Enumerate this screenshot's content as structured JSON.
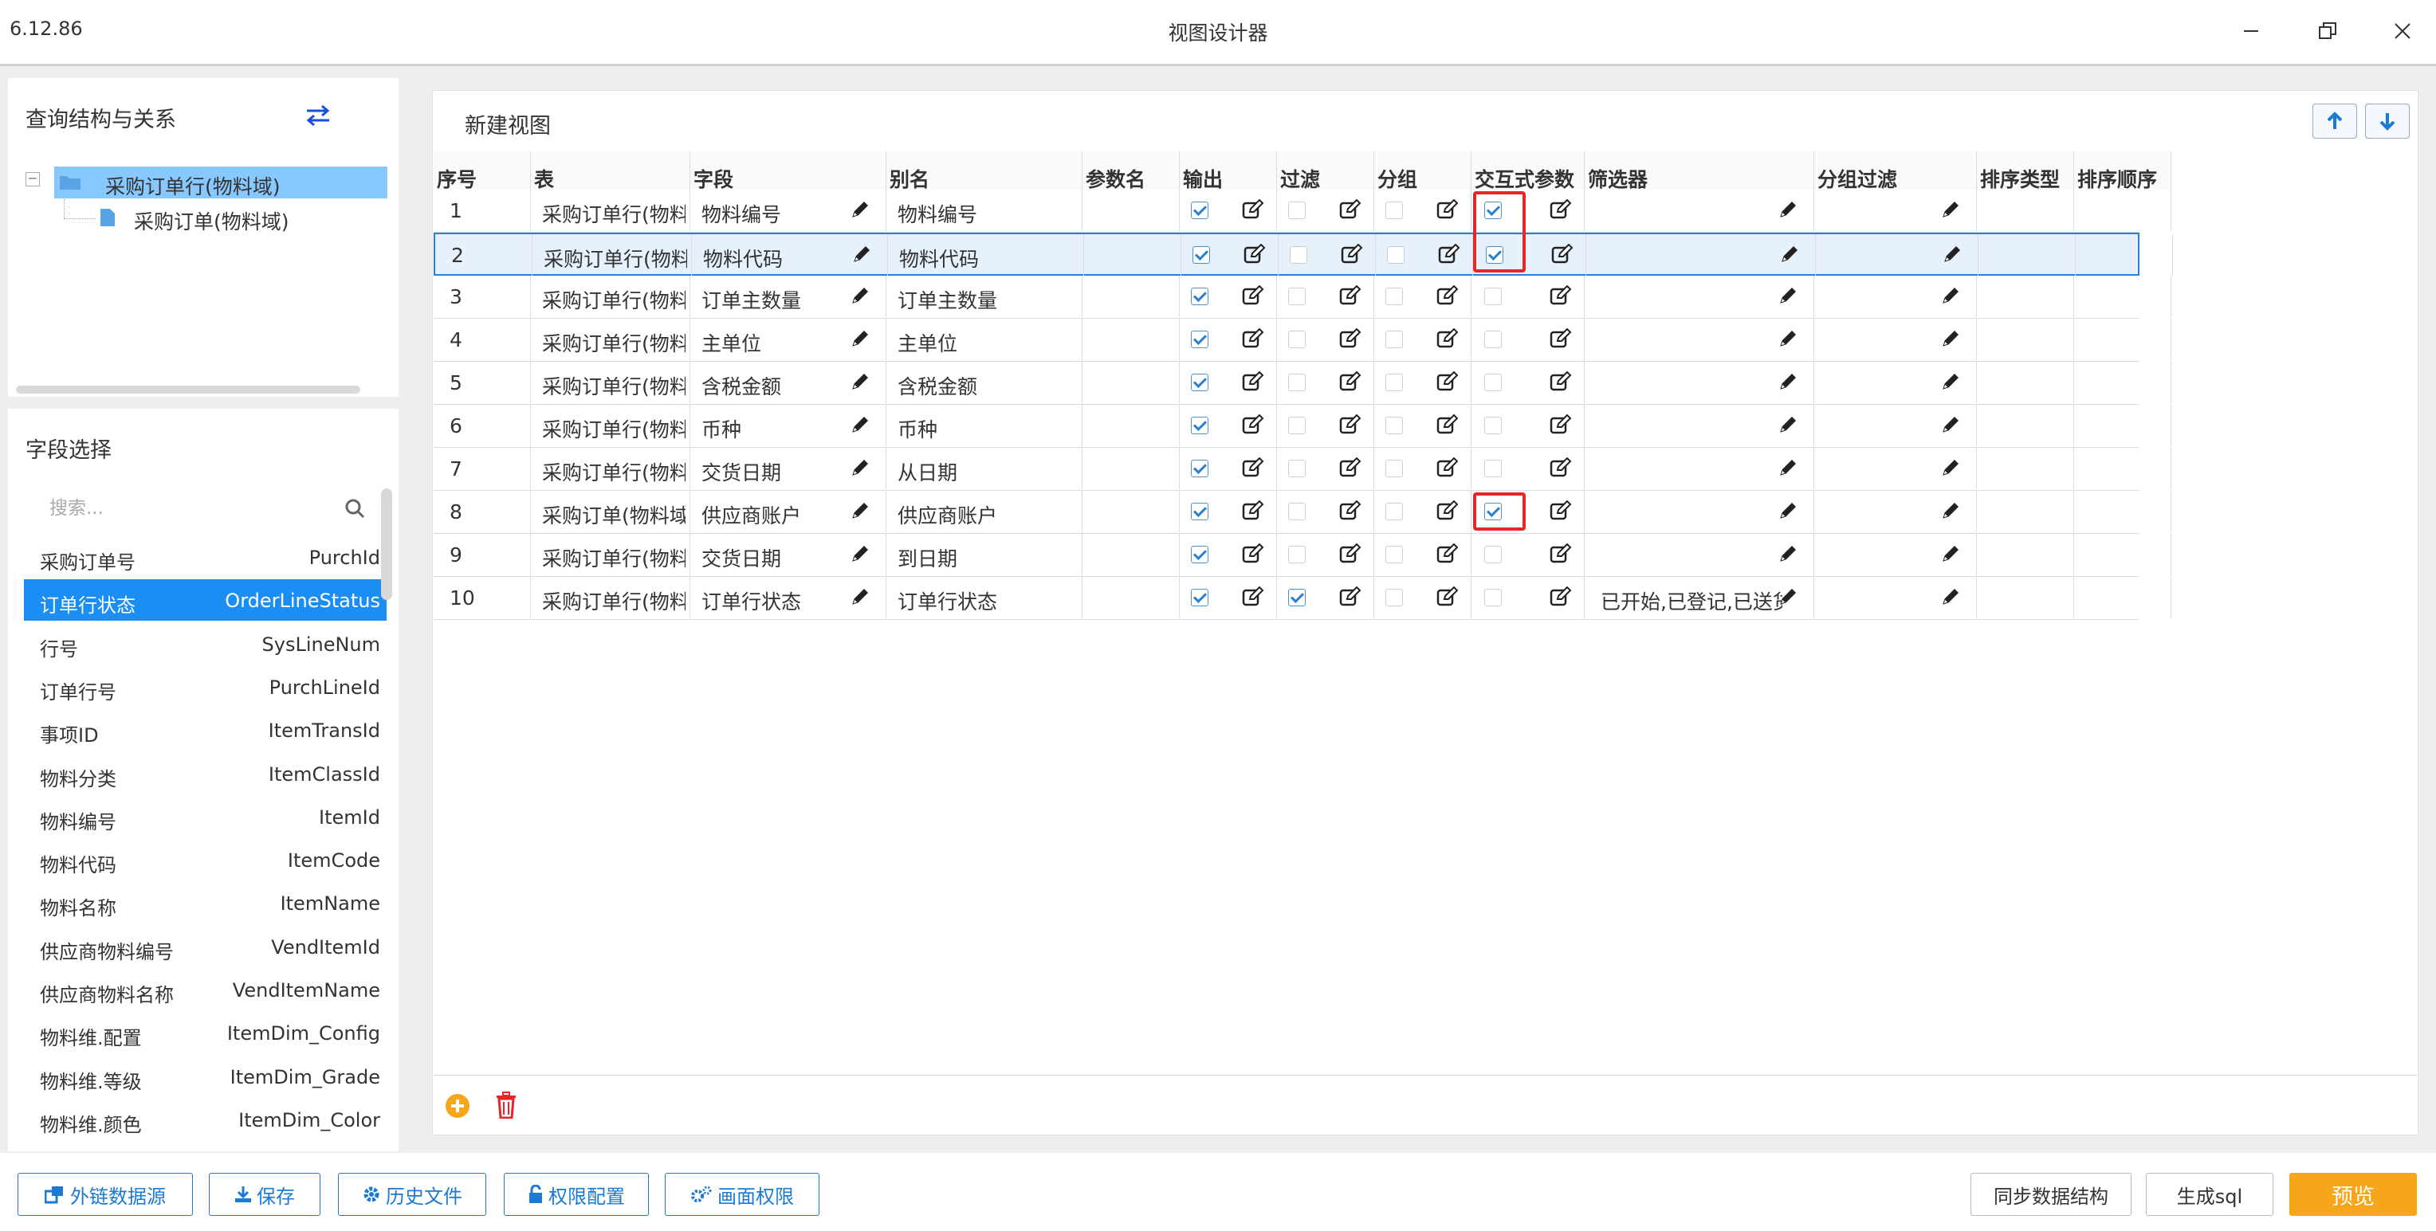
{
  "app": {
    "version": "6.12.86",
    "title": "视图设计器"
  },
  "colors": {
    "accent": "#1a8ef5",
    "preview_button": "#f7a51a",
    "highlight_box": "#e8262a",
    "tree_selected": "#87c8ff"
  },
  "left_top": {
    "title": "查询结构与关系",
    "swap_icon": "swap-arrows-icon",
    "tree": [
      {
        "label": "采购订单行(物料域)",
        "selected": true
      },
      {
        "label": "采购订单(物料域)",
        "selected": false
      }
    ]
  },
  "left_bottom": {
    "title": "字段选择",
    "search_placeholder": "搜索...",
    "fields": [
      {
        "cn": "采购订单号",
        "en": "PurchId"
      },
      {
        "cn": "订单行状态",
        "en": "OrderLineStatus"
      },
      {
        "cn": "行号",
        "en": "SysLineNum"
      },
      {
        "cn": "订单行号",
        "en": "PurchLineId"
      },
      {
        "cn": "事项ID",
        "en": "ItemTransId"
      },
      {
        "cn": "物料分类",
        "en": "ItemClassId"
      },
      {
        "cn": "物料编号",
        "en": "ItemId"
      },
      {
        "cn": "物料代码",
        "en": "ItemCode"
      },
      {
        "cn": "物料名称",
        "en": "ItemName"
      },
      {
        "cn": "供应商物料编号",
        "en": "VendItemId"
      },
      {
        "cn": "供应商物料名称",
        "en": "VendItemName"
      },
      {
        "cn": "物料维.配置",
        "en": "ItemDim_Config"
      },
      {
        "cn": "物料维.等级",
        "en": "ItemDim_Grade"
      },
      {
        "cn": "物料维.颜色",
        "en": "ItemDim_Color"
      }
    ],
    "selected_index": 1
  },
  "view": {
    "title": "新建视图",
    "columns": [
      "序号",
      "表",
      "字段",
      "别名",
      "参数名",
      "输出",
      "过滤",
      "分组",
      "交互式参数",
      "筛选器",
      "分组过滤",
      "排序类型",
      "排序顺序"
    ],
    "rows": [
      {
        "no": "1",
        "table": "采购订单行(物料",
        "field": "物料编号",
        "alias": "物料编号",
        "output": true,
        "filter": false,
        "group": false,
        "interactive": true,
        "filter_value": ""
      },
      {
        "no": "2",
        "table": "采购订单行(物料",
        "field": "物料代码",
        "alias": "物料代码",
        "output": true,
        "filter": false,
        "group": false,
        "interactive": true,
        "filter_value": ""
      },
      {
        "no": "3",
        "table": "采购订单行(物料",
        "field": "订单主数量",
        "alias": "订单主数量",
        "output": true,
        "filter": false,
        "group": false,
        "interactive": false,
        "filter_value": ""
      },
      {
        "no": "4",
        "table": "采购订单行(物料",
        "field": "主单位",
        "alias": "主单位",
        "output": true,
        "filter": false,
        "group": false,
        "interactive": false,
        "filter_value": ""
      },
      {
        "no": "5",
        "table": "采购订单行(物料",
        "field": "含税金额",
        "alias": "含税金额",
        "output": true,
        "filter": false,
        "group": false,
        "interactive": false,
        "filter_value": ""
      },
      {
        "no": "6",
        "table": "采购订单行(物料",
        "field": "币种",
        "alias": "币种",
        "output": true,
        "filter": false,
        "group": false,
        "interactive": false,
        "filter_value": ""
      },
      {
        "no": "7",
        "table": "采购订单行(物料",
        "field": "交货日期",
        "alias": "从日期",
        "output": true,
        "filter": false,
        "group": false,
        "interactive": false,
        "filter_value": ""
      },
      {
        "no": "8",
        "table": "采购订单(物料域",
        "field": "供应商账户",
        "alias": "供应商账户",
        "output": true,
        "filter": false,
        "group": false,
        "interactive": true,
        "filter_value": ""
      },
      {
        "no": "9",
        "table": "采购订单行(物料",
        "field": "交货日期",
        "alias": "到日期",
        "output": true,
        "filter": false,
        "group": false,
        "interactive": false,
        "filter_value": ""
      },
      {
        "no": "10",
        "table": "采购订单行(物料",
        "field": "订单行状态",
        "alias": "订单行状态",
        "output": true,
        "filter": true,
        "group": false,
        "interactive": false,
        "filter_value": "已开始,已登记,已送货"
      }
    ],
    "selected_row": 1
  },
  "bottom_buttons": {
    "external_source": "外链数据源",
    "save": "保存",
    "history": "历史文件",
    "permission": "权限配置",
    "screen_permission": "画面权限",
    "sync": "同步数据结构",
    "gen_sql": "生成sql",
    "preview": "预览"
  }
}
